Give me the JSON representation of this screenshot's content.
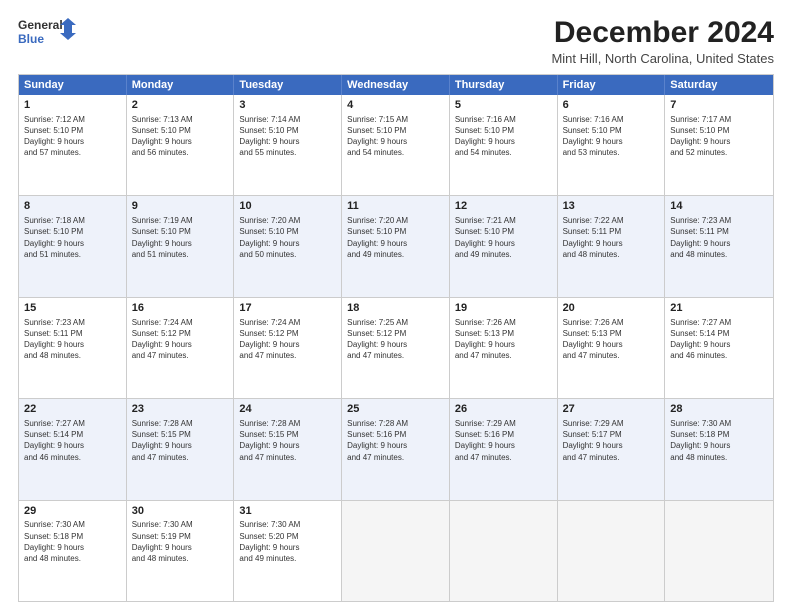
{
  "logo": {
    "line1": "General",
    "line2": "Blue"
  },
  "title": "December 2024",
  "subtitle": "Mint Hill, North Carolina, United States",
  "header_days": [
    "Sunday",
    "Monday",
    "Tuesday",
    "Wednesday",
    "Thursday",
    "Friday",
    "Saturday"
  ],
  "weeks": [
    [
      {
        "day": 1,
        "lines": [
          "Sunrise: 7:12 AM",
          "Sunset: 5:10 PM",
          "Daylight: 9 hours",
          "and 57 minutes."
        ]
      },
      {
        "day": 2,
        "lines": [
          "Sunrise: 7:13 AM",
          "Sunset: 5:10 PM",
          "Daylight: 9 hours",
          "and 56 minutes."
        ]
      },
      {
        "day": 3,
        "lines": [
          "Sunrise: 7:14 AM",
          "Sunset: 5:10 PM",
          "Daylight: 9 hours",
          "and 55 minutes."
        ]
      },
      {
        "day": 4,
        "lines": [
          "Sunrise: 7:15 AM",
          "Sunset: 5:10 PM",
          "Daylight: 9 hours",
          "and 54 minutes."
        ]
      },
      {
        "day": 5,
        "lines": [
          "Sunrise: 7:16 AM",
          "Sunset: 5:10 PM",
          "Daylight: 9 hours",
          "and 54 minutes."
        ]
      },
      {
        "day": 6,
        "lines": [
          "Sunrise: 7:16 AM",
          "Sunset: 5:10 PM",
          "Daylight: 9 hours",
          "and 53 minutes."
        ]
      },
      {
        "day": 7,
        "lines": [
          "Sunrise: 7:17 AM",
          "Sunset: 5:10 PM",
          "Daylight: 9 hours",
          "and 52 minutes."
        ]
      }
    ],
    [
      {
        "day": 8,
        "lines": [
          "Sunrise: 7:18 AM",
          "Sunset: 5:10 PM",
          "Daylight: 9 hours",
          "and 51 minutes."
        ]
      },
      {
        "day": 9,
        "lines": [
          "Sunrise: 7:19 AM",
          "Sunset: 5:10 PM",
          "Daylight: 9 hours",
          "and 51 minutes."
        ]
      },
      {
        "day": 10,
        "lines": [
          "Sunrise: 7:20 AM",
          "Sunset: 5:10 PM",
          "Daylight: 9 hours",
          "and 50 minutes."
        ]
      },
      {
        "day": 11,
        "lines": [
          "Sunrise: 7:20 AM",
          "Sunset: 5:10 PM",
          "Daylight: 9 hours",
          "and 49 minutes."
        ]
      },
      {
        "day": 12,
        "lines": [
          "Sunrise: 7:21 AM",
          "Sunset: 5:10 PM",
          "Daylight: 9 hours",
          "and 49 minutes."
        ]
      },
      {
        "day": 13,
        "lines": [
          "Sunrise: 7:22 AM",
          "Sunset: 5:11 PM",
          "Daylight: 9 hours",
          "and 48 minutes."
        ]
      },
      {
        "day": 14,
        "lines": [
          "Sunrise: 7:23 AM",
          "Sunset: 5:11 PM",
          "Daylight: 9 hours",
          "and 48 minutes."
        ]
      }
    ],
    [
      {
        "day": 15,
        "lines": [
          "Sunrise: 7:23 AM",
          "Sunset: 5:11 PM",
          "Daylight: 9 hours",
          "and 48 minutes."
        ]
      },
      {
        "day": 16,
        "lines": [
          "Sunrise: 7:24 AM",
          "Sunset: 5:12 PM",
          "Daylight: 9 hours",
          "and 47 minutes."
        ]
      },
      {
        "day": 17,
        "lines": [
          "Sunrise: 7:24 AM",
          "Sunset: 5:12 PM",
          "Daylight: 9 hours",
          "and 47 minutes."
        ]
      },
      {
        "day": 18,
        "lines": [
          "Sunrise: 7:25 AM",
          "Sunset: 5:12 PM",
          "Daylight: 9 hours",
          "and 47 minutes."
        ]
      },
      {
        "day": 19,
        "lines": [
          "Sunrise: 7:26 AM",
          "Sunset: 5:13 PM",
          "Daylight: 9 hours",
          "and 47 minutes."
        ]
      },
      {
        "day": 20,
        "lines": [
          "Sunrise: 7:26 AM",
          "Sunset: 5:13 PM",
          "Daylight: 9 hours",
          "and 47 minutes."
        ]
      },
      {
        "day": 21,
        "lines": [
          "Sunrise: 7:27 AM",
          "Sunset: 5:14 PM",
          "Daylight: 9 hours",
          "and 46 minutes."
        ]
      }
    ],
    [
      {
        "day": 22,
        "lines": [
          "Sunrise: 7:27 AM",
          "Sunset: 5:14 PM",
          "Daylight: 9 hours",
          "and 46 minutes."
        ]
      },
      {
        "day": 23,
        "lines": [
          "Sunrise: 7:28 AM",
          "Sunset: 5:15 PM",
          "Daylight: 9 hours",
          "and 47 minutes."
        ]
      },
      {
        "day": 24,
        "lines": [
          "Sunrise: 7:28 AM",
          "Sunset: 5:15 PM",
          "Daylight: 9 hours",
          "and 47 minutes."
        ]
      },
      {
        "day": 25,
        "lines": [
          "Sunrise: 7:28 AM",
          "Sunset: 5:16 PM",
          "Daylight: 9 hours",
          "and 47 minutes."
        ]
      },
      {
        "day": 26,
        "lines": [
          "Sunrise: 7:29 AM",
          "Sunset: 5:16 PM",
          "Daylight: 9 hours",
          "and 47 minutes."
        ]
      },
      {
        "day": 27,
        "lines": [
          "Sunrise: 7:29 AM",
          "Sunset: 5:17 PM",
          "Daylight: 9 hours",
          "and 47 minutes."
        ]
      },
      {
        "day": 28,
        "lines": [
          "Sunrise: 7:30 AM",
          "Sunset: 5:18 PM",
          "Daylight: 9 hours",
          "and 48 minutes."
        ]
      }
    ],
    [
      {
        "day": 29,
        "lines": [
          "Sunrise: 7:30 AM",
          "Sunset: 5:18 PM",
          "Daylight: 9 hours",
          "and 48 minutes."
        ]
      },
      {
        "day": 30,
        "lines": [
          "Sunrise: 7:30 AM",
          "Sunset: 5:19 PM",
          "Daylight: 9 hours",
          "and 48 minutes."
        ]
      },
      {
        "day": 31,
        "lines": [
          "Sunrise: 7:30 AM",
          "Sunset: 5:20 PM",
          "Daylight: 9 hours",
          "and 49 minutes."
        ]
      },
      null,
      null,
      null,
      null
    ]
  ]
}
